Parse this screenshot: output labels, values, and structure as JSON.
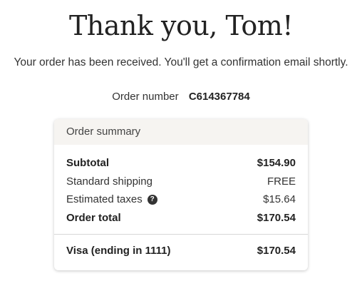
{
  "header": {
    "title": "Thank you, Tom!",
    "subtitle": "Your order has been received. You'll get a confirmation email shortly."
  },
  "order": {
    "number_label": "Order number",
    "number_value": "C614367784"
  },
  "summary": {
    "title": "Order summary",
    "subtotal_label": "Subtotal",
    "subtotal_value": "$154.90",
    "shipping_label": "Standard shipping",
    "shipping_value": "FREE",
    "taxes_label": "Estimated taxes",
    "taxes_help_icon": "?",
    "taxes_value": "$15.64",
    "total_label": "Order total",
    "total_value": "$170.54"
  },
  "payment": {
    "method_label": "Visa (ending in 1111)",
    "amount": "$170.54"
  }
}
